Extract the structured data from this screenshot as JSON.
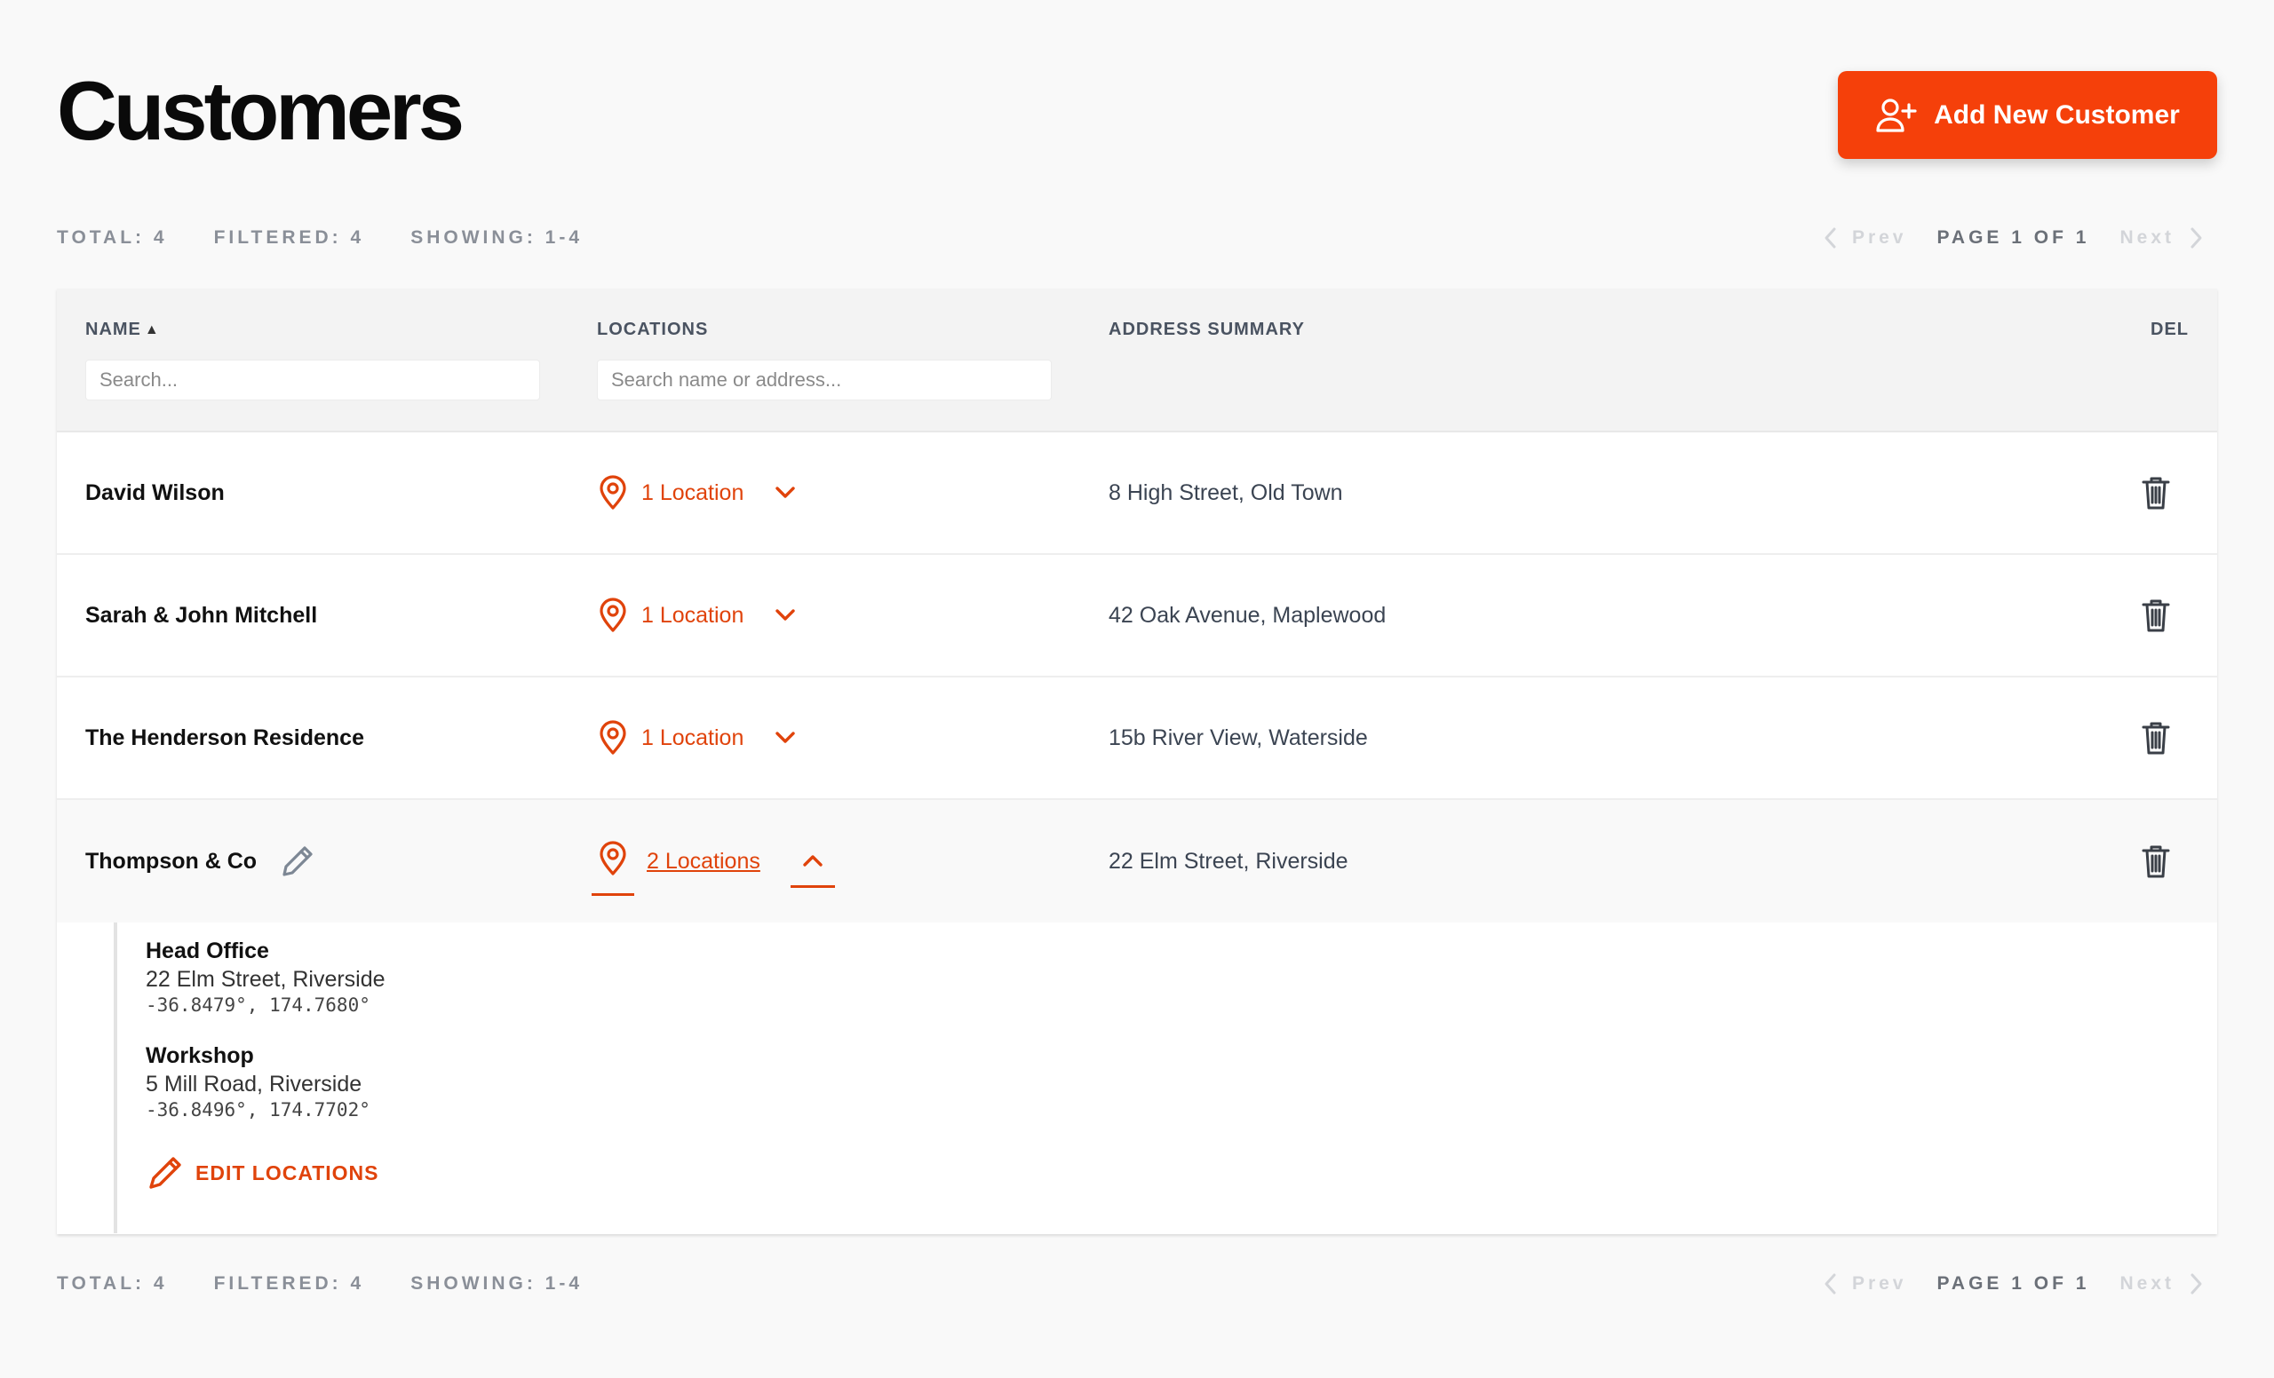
{
  "header": {
    "title": "Customers",
    "add_button_label": "Add New Customer"
  },
  "stats": {
    "total": "TOTAL: 4",
    "filtered": "FILTERED: 4",
    "showing": "SHOWING: 1-4",
    "prev": "Prev",
    "page": "PAGE 1 OF 1",
    "next": "Next"
  },
  "table": {
    "columns": {
      "name": "NAME",
      "locations": "LOCATIONS",
      "address": "ADDRESS SUMMARY",
      "del": "DEL"
    },
    "filters": {
      "name_placeholder": "Search...",
      "locations_placeholder": "Search name or address..."
    },
    "rows": [
      {
        "name": "David Wilson",
        "locations": "1 Location",
        "address": "8 High Street, Old Town"
      },
      {
        "name": "Sarah & John Mitchell",
        "locations": "1 Location",
        "address": "42 Oak Avenue, Maplewood"
      },
      {
        "name": "The Henderson Residence",
        "locations": "1 Location",
        "address": "15b River View, Waterside"
      },
      {
        "name": "Thompson & Co",
        "locations": "2 Locations",
        "address": "22 Elm Street, Riverside"
      }
    ],
    "expanded": {
      "locations": [
        {
          "name": "Head Office",
          "address": "22 Elm Street, Riverside",
          "coords": "-36.8479°, 174.7680°"
        },
        {
          "name": "Workshop",
          "address": "5 Mill Road, Riverside",
          "coords": "-36.8496°, 174.7702°"
        }
      ],
      "edit_label": "EDIT LOCATIONS"
    }
  },
  "colors": {
    "accent": "#f5400a",
    "accent_text": "#e0430b",
    "background": "#f9f9f9"
  },
  "icons": {
    "add_button": "user-plus-icon",
    "location": "map-pin-icon",
    "expand": "chevron-down-icon",
    "collapse": "chevron-up-icon",
    "delete": "trash-icon",
    "edit": "pencil-icon"
  }
}
